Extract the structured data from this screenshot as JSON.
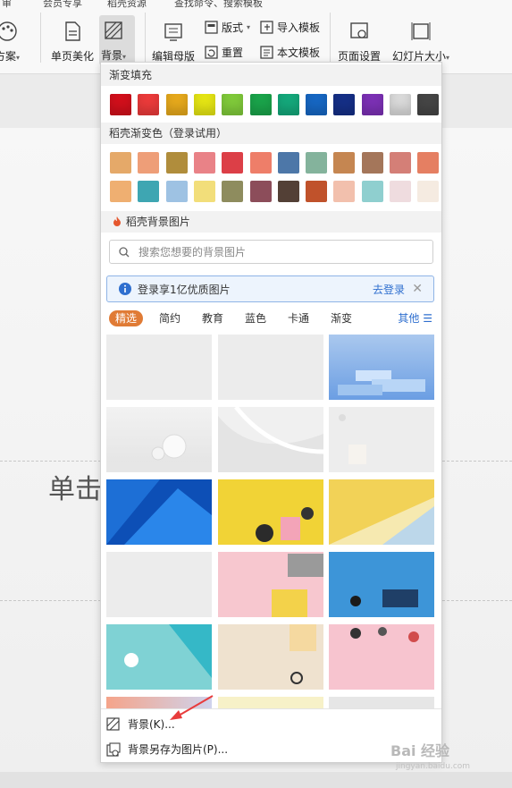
{
  "menubar": [
    "审",
    "会员专享",
    "稻壳资源",
    "查找命令、搜索模板"
  ],
  "ribbon": {
    "scheme": "方案",
    "page_beautify": "单页美化",
    "background": "背景",
    "edit_master": "编辑母版",
    "layout": "版式",
    "import_template": "导入模板",
    "reset": "重置",
    "text_template": "本文模板",
    "page_setup": "页面设置",
    "slide_size": "幻灯片大小"
  },
  "slide": {
    "title": "单击"
  },
  "dropdown": {
    "gradient_fill_title": "渐变填充",
    "gradient_colors": [
      "#d10f1b",
      "#ea3a3a",
      "#e5a81c",
      "#e4e414",
      "#7fc93a",
      "#1aa34a",
      "#14a77a",
      "#1666c2",
      "#152f86",
      "#7b30b4",
      "#d9d9d9",
      "#454545"
    ],
    "docer_gradient_title": "稻壳渐变色（登录试用）",
    "docer_colors_row1": [
      "#e5a969",
      "#ee9e78",
      "#b08d3c",
      "#e98287",
      "#dc3f47",
      "#ee7e69",
      "#4d77a8",
      "#84b39c",
      "#c58651",
      "#a4765a",
      "#d47f77",
      "#e57f62"
    ],
    "docer_colors_row2": [
      "#efaf71",
      "#3ea6b2",
      "#9ec2e3",
      "#f2de7a",
      "#8e8c5e",
      "#8c4d5a",
      "#534036",
      "#c0522b",
      "#f2c0ad",
      "#8fcfcf",
      "#efdcdf",
      "#f5ebe1"
    ],
    "docer_bg_title": "稻壳背景图片",
    "search_placeholder": "搜索您想要的背景图片",
    "banner_text": "登录享1亿优质图片",
    "banner_login": "去登录",
    "banner_close": "✕",
    "tabs": [
      "精选",
      "简约",
      "教育",
      "蓝色",
      "卡通",
      "渐变"
    ],
    "more_label": "其他",
    "footer_items": [
      "背景(K)...",
      "背景另存为图片(P)..."
    ]
  },
  "watermark": {
    "main": "Bai 经验",
    "sub": "jingyan.baidu.com"
  }
}
